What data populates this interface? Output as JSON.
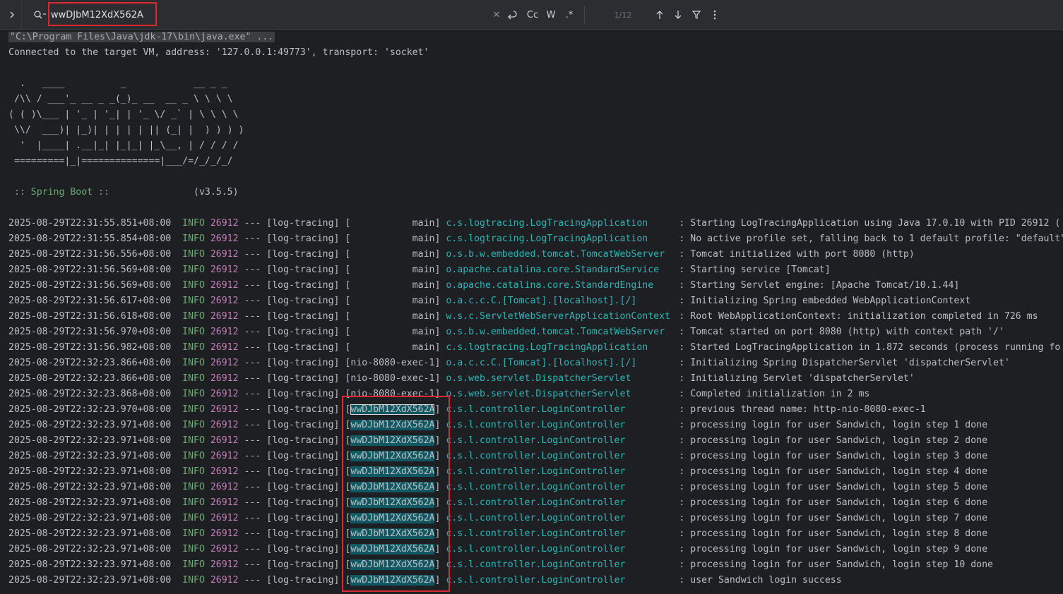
{
  "search": {
    "query": "wwDJbM12XdX562A",
    "match_count": "1/12",
    "options": [
      {
        "name": "case-sensitive-toggle",
        "glyph": "Cc"
      },
      {
        "name": "whole-words-toggle",
        "glyph": "W"
      },
      {
        "name": "regex-toggle",
        "glyph": ".*"
      }
    ]
  },
  "console": {
    "command": "\"C:\\Program Files\\Java\\jdk-17\\bin\\java.exe\" ...",
    "connected": "Connected to the target VM, address: '127.0.0.1:49773', transport: 'socket'",
    "banner": [
      "  .   ____          _            __ _ _",
      " /\\\\ / ___'_ __ _ _(_)_ __  __ _ \\ \\ \\ \\",
      "( ( )\\___ | '_ | '_| | '_ \\/ _` | \\ \\ \\ \\",
      " \\\\/  ___)| |_)| | | | | || (_| |  ) ) ) )",
      "  '  |____| .__|_| |_|_| |_\\__, | / / / /",
      " =========|_|==============|___/=/_/_/_/"
    ],
    "spring_label": " :: Spring Boot :: ",
    "spring_version": "              (v3.5.5)",
    "logs": [
      {
        "ts": "2025-08-29T22:31:55.851+08:00",
        "level": "INFO",
        "pid": "26912",
        "app": "[log-tracing]",
        "thread": "           main",
        "logger": "c.s.logtracing.LogTracingApplication",
        "msg": "Starting LogTracingApplication using Java 17.0.10 with PID 26912 ("
      },
      {
        "ts": "2025-08-29T22:31:55.854+08:00",
        "level": "INFO",
        "pid": "26912",
        "app": "[log-tracing]",
        "thread": "           main",
        "logger": "c.s.logtracing.LogTracingApplication",
        "msg": "No active profile set, falling back to 1 default profile: \"default\""
      },
      {
        "ts": "2025-08-29T22:31:56.556+08:00",
        "level": "INFO",
        "pid": "26912",
        "app": "[log-tracing]",
        "thread": "           main",
        "logger": "o.s.b.w.embedded.tomcat.TomcatWebServer",
        "msg": "Tomcat initialized with port 8080 (http)"
      },
      {
        "ts": "2025-08-29T22:31:56.569+08:00",
        "level": "INFO",
        "pid": "26912",
        "app": "[log-tracing]",
        "thread": "           main",
        "logger": "o.apache.catalina.core.StandardService",
        "msg": "Starting service [Tomcat]"
      },
      {
        "ts": "2025-08-29T22:31:56.569+08:00",
        "level": "INFO",
        "pid": "26912",
        "app": "[log-tracing]",
        "thread": "           main",
        "logger": "o.apache.catalina.core.StandardEngine",
        "msg": "Starting Servlet engine: [Apache Tomcat/10.1.44]"
      },
      {
        "ts": "2025-08-29T22:31:56.617+08:00",
        "level": "INFO",
        "pid": "26912",
        "app": "[log-tracing]",
        "thread": "           main",
        "logger": "o.a.c.c.C.[Tomcat].[localhost].[/]",
        "msg": "Initializing Spring embedded WebApplicationContext"
      },
      {
        "ts": "2025-08-29T22:31:56.618+08:00",
        "level": "INFO",
        "pid": "26912",
        "app": "[log-tracing]",
        "thread": "           main",
        "logger": "w.s.c.ServletWebServerApplicationContext",
        "msg": "Root WebApplicationContext: initialization completed in 726 ms"
      },
      {
        "ts": "2025-08-29T22:31:56.970+08:00",
        "level": "INFO",
        "pid": "26912",
        "app": "[log-tracing]",
        "thread": "           main",
        "logger": "o.s.b.w.embedded.tomcat.TomcatWebServer",
        "msg": "Tomcat started on port 8080 (http) with context path '/'"
      },
      {
        "ts": "2025-08-29T22:31:56.982+08:00",
        "level": "INFO",
        "pid": "26912",
        "app": "[log-tracing]",
        "thread": "           main",
        "logger": "c.s.logtracing.LogTracingApplication",
        "msg": "Started LogTracingApplication in 1.872 seconds (process running fo"
      },
      {
        "ts": "2025-08-29T22:32:23.866+08:00",
        "level": "INFO",
        "pid": "26912",
        "app": "[log-tracing]",
        "thread": "nio-8080-exec-1",
        "logger": "o.a.c.c.C.[Tomcat].[localhost].[/]",
        "msg": "Initializing Spring DispatcherServlet 'dispatcherServlet'"
      },
      {
        "ts": "2025-08-29T22:32:23.866+08:00",
        "level": "INFO",
        "pid": "26912",
        "app": "[log-tracing]",
        "thread": "nio-8080-exec-1",
        "logger": "o.s.web.servlet.DispatcherServlet",
        "msg": "Initializing Servlet 'dispatcherServlet'"
      },
      {
        "ts": "2025-08-29T22:32:23.868+08:00",
        "level": "INFO",
        "pid": "26912",
        "app": "[log-tracing]",
        "thread": "nio-8080-exec-1",
        "logger": "o.s.web.servlet.DispatcherServlet",
        "msg": "Completed initialization in 2 ms"
      },
      {
        "ts": "2025-08-29T22:32:23.970+08:00",
        "level": "INFO",
        "pid": "26912",
        "app": "[log-tracing]",
        "thread": "wwDJbM12XdX562A",
        "match": true,
        "current": true,
        "logger": "c.s.l.controller.LoginController",
        "msg": "previous thread name: http-nio-8080-exec-1"
      },
      {
        "ts": "2025-08-29T22:32:23.971+08:00",
        "level": "INFO",
        "pid": "26912",
        "app": "[log-tracing]",
        "thread": "wwDJbM12XdX562A",
        "match": true,
        "logger": "c.s.l.controller.LoginController",
        "msg": "processing login for user Sandwich, login step 1 done"
      },
      {
        "ts": "2025-08-29T22:32:23.971+08:00",
        "level": "INFO",
        "pid": "26912",
        "app": "[log-tracing]",
        "thread": "wwDJbM12XdX562A",
        "match": true,
        "logger": "c.s.l.controller.LoginController",
        "msg": "processing login for user Sandwich, login step 2 done"
      },
      {
        "ts": "2025-08-29T22:32:23.971+08:00",
        "level": "INFO",
        "pid": "26912",
        "app": "[log-tracing]",
        "thread": "wwDJbM12XdX562A",
        "match": true,
        "logger": "c.s.l.controller.LoginController",
        "msg": "processing login for user Sandwich, login step 3 done"
      },
      {
        "ts": "2025-08-29T22:32:23.971+08:00",
        "level": "INFO",
        "pid": "26912",
        "app": "[log-tracing]",
        "thread": "wwDJbM12XdX562A",
        "match": true,
        "logger": "c.s.l.controller.LoginController",
        "msg": "processing login for user Sandwich, login step 4 done"
      },
      {
        "ts": "2025-08-29T22:32:23.971+08:00",
        "level": "INFO",
        "pid": "26912",
        "app": "[log-tracing]",
        "thread": "wwDJbM12XdX562A",
        "match": true,
        "logger": "c.s.l.controller.LoginController",
        "msg": "processing login for user Sandwich, login step 5 done"
      },
      {
        "ts": "2025-08-29T22:32:23.971+08:00",
        "level": "INFO",
        "pid": "26912",
        "app": "[log-tracing]",
        "thread": "wwDJbM12XdX562A",
        "match": true,
        "logger": "c.s.l.controller.LoginController",
        "msg": "processing login for user Sandwich, login step 6 done"
      },
      {
        "ts": "2025-08-29T22:32:23.971+08:00",
        "level": "INFO",
        "pid": "26912",
        "app": "[log-tracing]",
        "thread": "wwDJbM12XdX562A",
        "match": true,
        "logger": "c.s.l.controller.LoginController",
        "msg": "processing login for user Sandwich, login step 7 done"
      },
      {
        "ts": "2025-08-29T22:32:23.971+08:00",
        "level": "INFO",
        "pid": "26912",
        "app": "[log-tracing]",
        "thread": "wwDJbM12XdX562A",
        "match": true,
        "logger": "c.s.l.controller.LoginController",
        "msg": "processing login for user Sandwich, login step 8 done"
      },
      {
        "ts": "2025-08-29T22:32:23.971+08:00",
        "level": "INFO",
        "pid": "26912",
        "app": "[log-tracing]",
        "thread": "wwDJbM12XdX562A",
        "match": true,
        "logger": "c.s.l.controller.LoginController",
        "msg": "processing login for user Sandwich, login step 9 done"
      },
      {
        "ts": "2025-08-29T22:32:23.971+08:00",
        "level": "INFO",
        "pid": "26912",
        "app": "[log-tracing]",
        "thread": "wwDJbM12XdX562A",
        "match": true,
        "logger": "c.s.l.controller.LoginController",
        "msg": "processing login for user Sandwich, login step 10 done"
      },
      {
        "ts": "2025-08-29T22:32:23.971+08:00",
        "level": "INFO",
        "pid": "26912",
        "app": "[log-tracing]",
        "thread": "wwDJbM12XdX562A",
        "match": true,
        "logger": "c.s.l.controller.LoginController",
        "msg": "user Sandwich login success"
      }
    ]
  },
  "colors": {
    "background": "#1e1f22",
    "toolbar": "#2b2d30",
    "info_level": "#6aab73",
    "pid": "#c77dbb",
    "logger": "#2fb5b5",
    "match_highlight": "#115962",
    "annotation": "#e0262e"
  }
}
